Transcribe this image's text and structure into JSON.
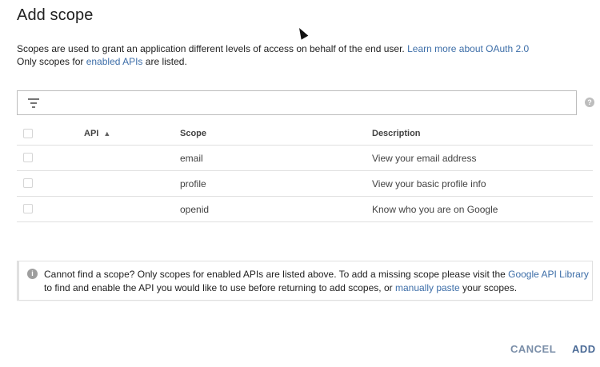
{
  "dialog": {
    "title": "Add scope",
    "intro_line1": "Scopes are used to grant an application different levels of access on behalf of the end user. ",
    "intro_link1": "Learn more about OAuth 2.0",
    "intro_line2_a": "Only scopes for ",
    "intro_link2": "enabled APIs",
    "intro_line2_b": " are listed."
  },
  "filter": {
    "placeholder": "",
    "icon": "filter-icon",
    "help_icon": "?"
  },
  "table": {
    "headers": {
      "api": "API",
      "scope": "Scope",
      "description": "Description"
    },
    "sort_icon": "▲",
    "rows": [
      {
        "api": "",
        "scope": "email",
        "description": "View your email address"
      },
      {
        "api": "",
        "scope": "profile",
        "description": "View your basic profile info"
      },
      {
        "api": "",
        "scope": "openid",
        "description": "Know who you are on Google"
      }
    ]
  },
  "notice": {
    "icon": "i",
    "text_a": "Cannot find a scope? Only scopes for enabled APIs are listed above. To add a missing scope please visit the ",
    "link_library": "Google API Library",
    "text_b": " to find and enable the API you would like to use before returning to add scopes, or ",
    "link_manual": "manually paste",
    "text_c": " your scopes."
  },
  "actions": {
    "cancel": "CANCEL",
    "add": "ADD"
  },
  "colors": {
    "link": "#3d6ea8",
    "button": "#4a6a96"
  }
}
